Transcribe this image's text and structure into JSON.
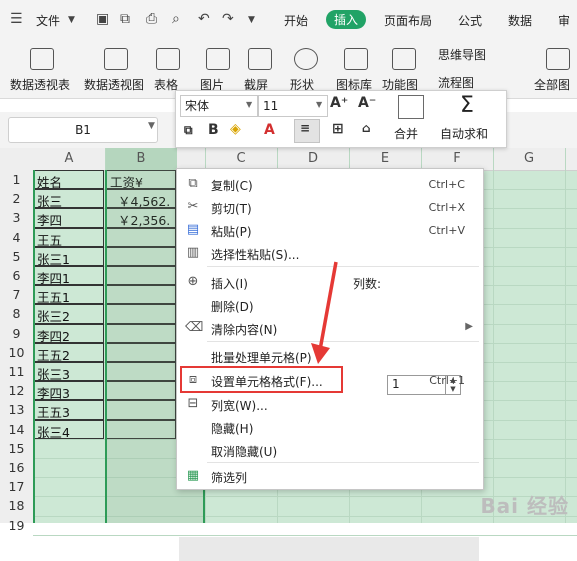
{
  "menu_button": "文件",
  "tabs": [
    "开始",
    "插入",
    "页面布局",
    "公式",
    "数据",
    "审"
  ],
  "ribbon": {
    "pivot_table": "数据透视表",
    "pivot_chart": "数据透视图",
    "table": "表格",
    "picture": "图片",
    "screenshot": "截屏",
    "shape": "形状",
    "icon_lib": "图标库",
    "function_chart": "功能图",
    "mind_map": "思维导图",
    "flowchart": "流程图",
    "all_charts": "全部图"
  },
  "name_box": "B1",
  "format_toolbar": {
    "font": "宋体",
    "size": "11",
    "merge": "合并",
    "autosum": "自动求和"
  },
  "columns": [
    "A",
    "B",
    "C",
    "D",
    "E",
    "F",
    "G"
  ],
  "rows": [
    "1",
    "2",
    "3",
    "4",
    "5",
    "6",
    "7",
    "8",
    "9",
    "10",
    "11",
    "12",
    "13",
    "14",
    "15",
    "16",
    "17",
    "18",
    "19"
  ],
  "cells": {
    "a": [
      "姓名",
      "张三",
      "李四",
      "王五",
      "张三1",
      "李四1",
      "王五1",
      "张三2",
      "李四2",
      "王五2",
      "张三3",
      "李四3",
      "王五3",
      "张三4"
    ],
    "b": [
      "工资¥",
      "￥4,562.",
      "￥2,356."
    ]
  },
  "context_menu": {
    "copy": "复制(C)",
    "copy_sc": "Ctrl+C",
    "cut": "剪切(T)",
    "cut_sc": "Ctrl+X",
    "paste": "粘贴(P)",
    "paste_sc": "Ctrl+V",
    "paste_special": "选择性粘贴(S)...",
    "insert": "插入(I)",
    "insert_cols_label": "列数:",
    "insert_cols_value": "1",
    "delete": "删除(D)",
    "clear": "清除内容(N)",
    "batch": "批量处理单元格(P)",
    "format_cells": "设置单元格格式(F)...",
    "format_sc": "Ctrl+1",
    "col_width": "列宽(W)...",
    "hide": "隐藏(H)",
    "unhide": "取消隐藏(U)",
    "filter": "筛选列"
  },
  "watermark": "Bai 经验"
}
